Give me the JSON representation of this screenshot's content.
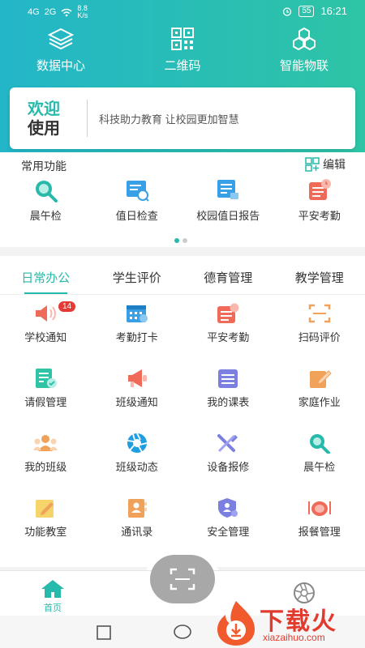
{
  "status": {
    "net1": "4G",
    "net2": "2G",
    "speed": "8.8 K/s",
    "battery": "55",
    "time": "16:21"
  },
  "topnav": [
    {
      "label": "数据中心",
      "icon": "layers-icon"
    },
    {
      "label": "二维码",
      "icon": "qrcode-icon"
    },
    {
      "label": "智能物联",
      "icon": "hexagon-cluster-icon"
    }
  ],
  "welcome": {
    "line1": "欢迎",
    "line2": "使用",
    "slogan": "科技助力教育  让校园更加智慧"
  },
  "common": {
    "title": "常用功能",
    "edit": "编辑",
    "items": [
      {
        "label": "晨午检",
        "icon": "search-icon"
      },
      {
        "label": "值日检查",
        "icon": "duty-check-icon"
      },
      {
        "label": "校园值日报告",
        "icon": "report-icon"
      },
      {
        "label": "平安考勤",
        "icon": "attendance-icon"
      }
    ]
  },
  "tabs": [
    "日常办公",
    "学生评价",
    "德育管理",
    "教学管理"
  ],
  "apps": [
    {
      "label": "学校通知",
      "icon": "speaker-icon",
      "badge": "14"
    },
    {
      "label": "考勤打卡",
      "icon": "calendar-icon"
    },
    {
      "label": "平安考勤",
      "icon": "attendance-icon"
    },
    {
      "label": "扫码评价",
      "icon": "scan-icon"
    },
    {
      "label": "请假管理",
      "icon": "leave-icon"
    },
    {
      "label": "班级通知",
      "icon": "megaphone-icon"
    },
    {
      "label": "我的课表",
      "icon": "schedule-icon"
    },
    {
      "label": "家庭作业",
      "icon": "homework-icon"
    },
    {
      "label": "我的班级",
      "icon": "class-icon"
    },
    {
      "label": "班级动态",
      "icon": "aperture-icon"
    },
    {
      "label": "设备报修",
      "icon": "tools-icon"
    },
    {
      "label": "晨午检",
      "icon": "search-icon"
    },
    {
      "label": "功能教室",
      "icon": "classroom-icon"
    },
    {
      "label": "通讯录",
      "icon": "contacts-icon"
    },
    {
      "label": "安全管理",
      "icon": "shield-icon"
    },
    {
      "label": "报餐管理",
      "icon": "meal-icon"
    }
  ],
  "bottom": {
    "home": "首页"
  },
  "watermark": {
    "text": "下载火",
    "url": "xiazaihuo.com"
  },
  "colors": {
    "accent": "#27b9a9",
    "header_start": "#23b6c8",
    "header_end": "#2ec4a5"
  }
}
